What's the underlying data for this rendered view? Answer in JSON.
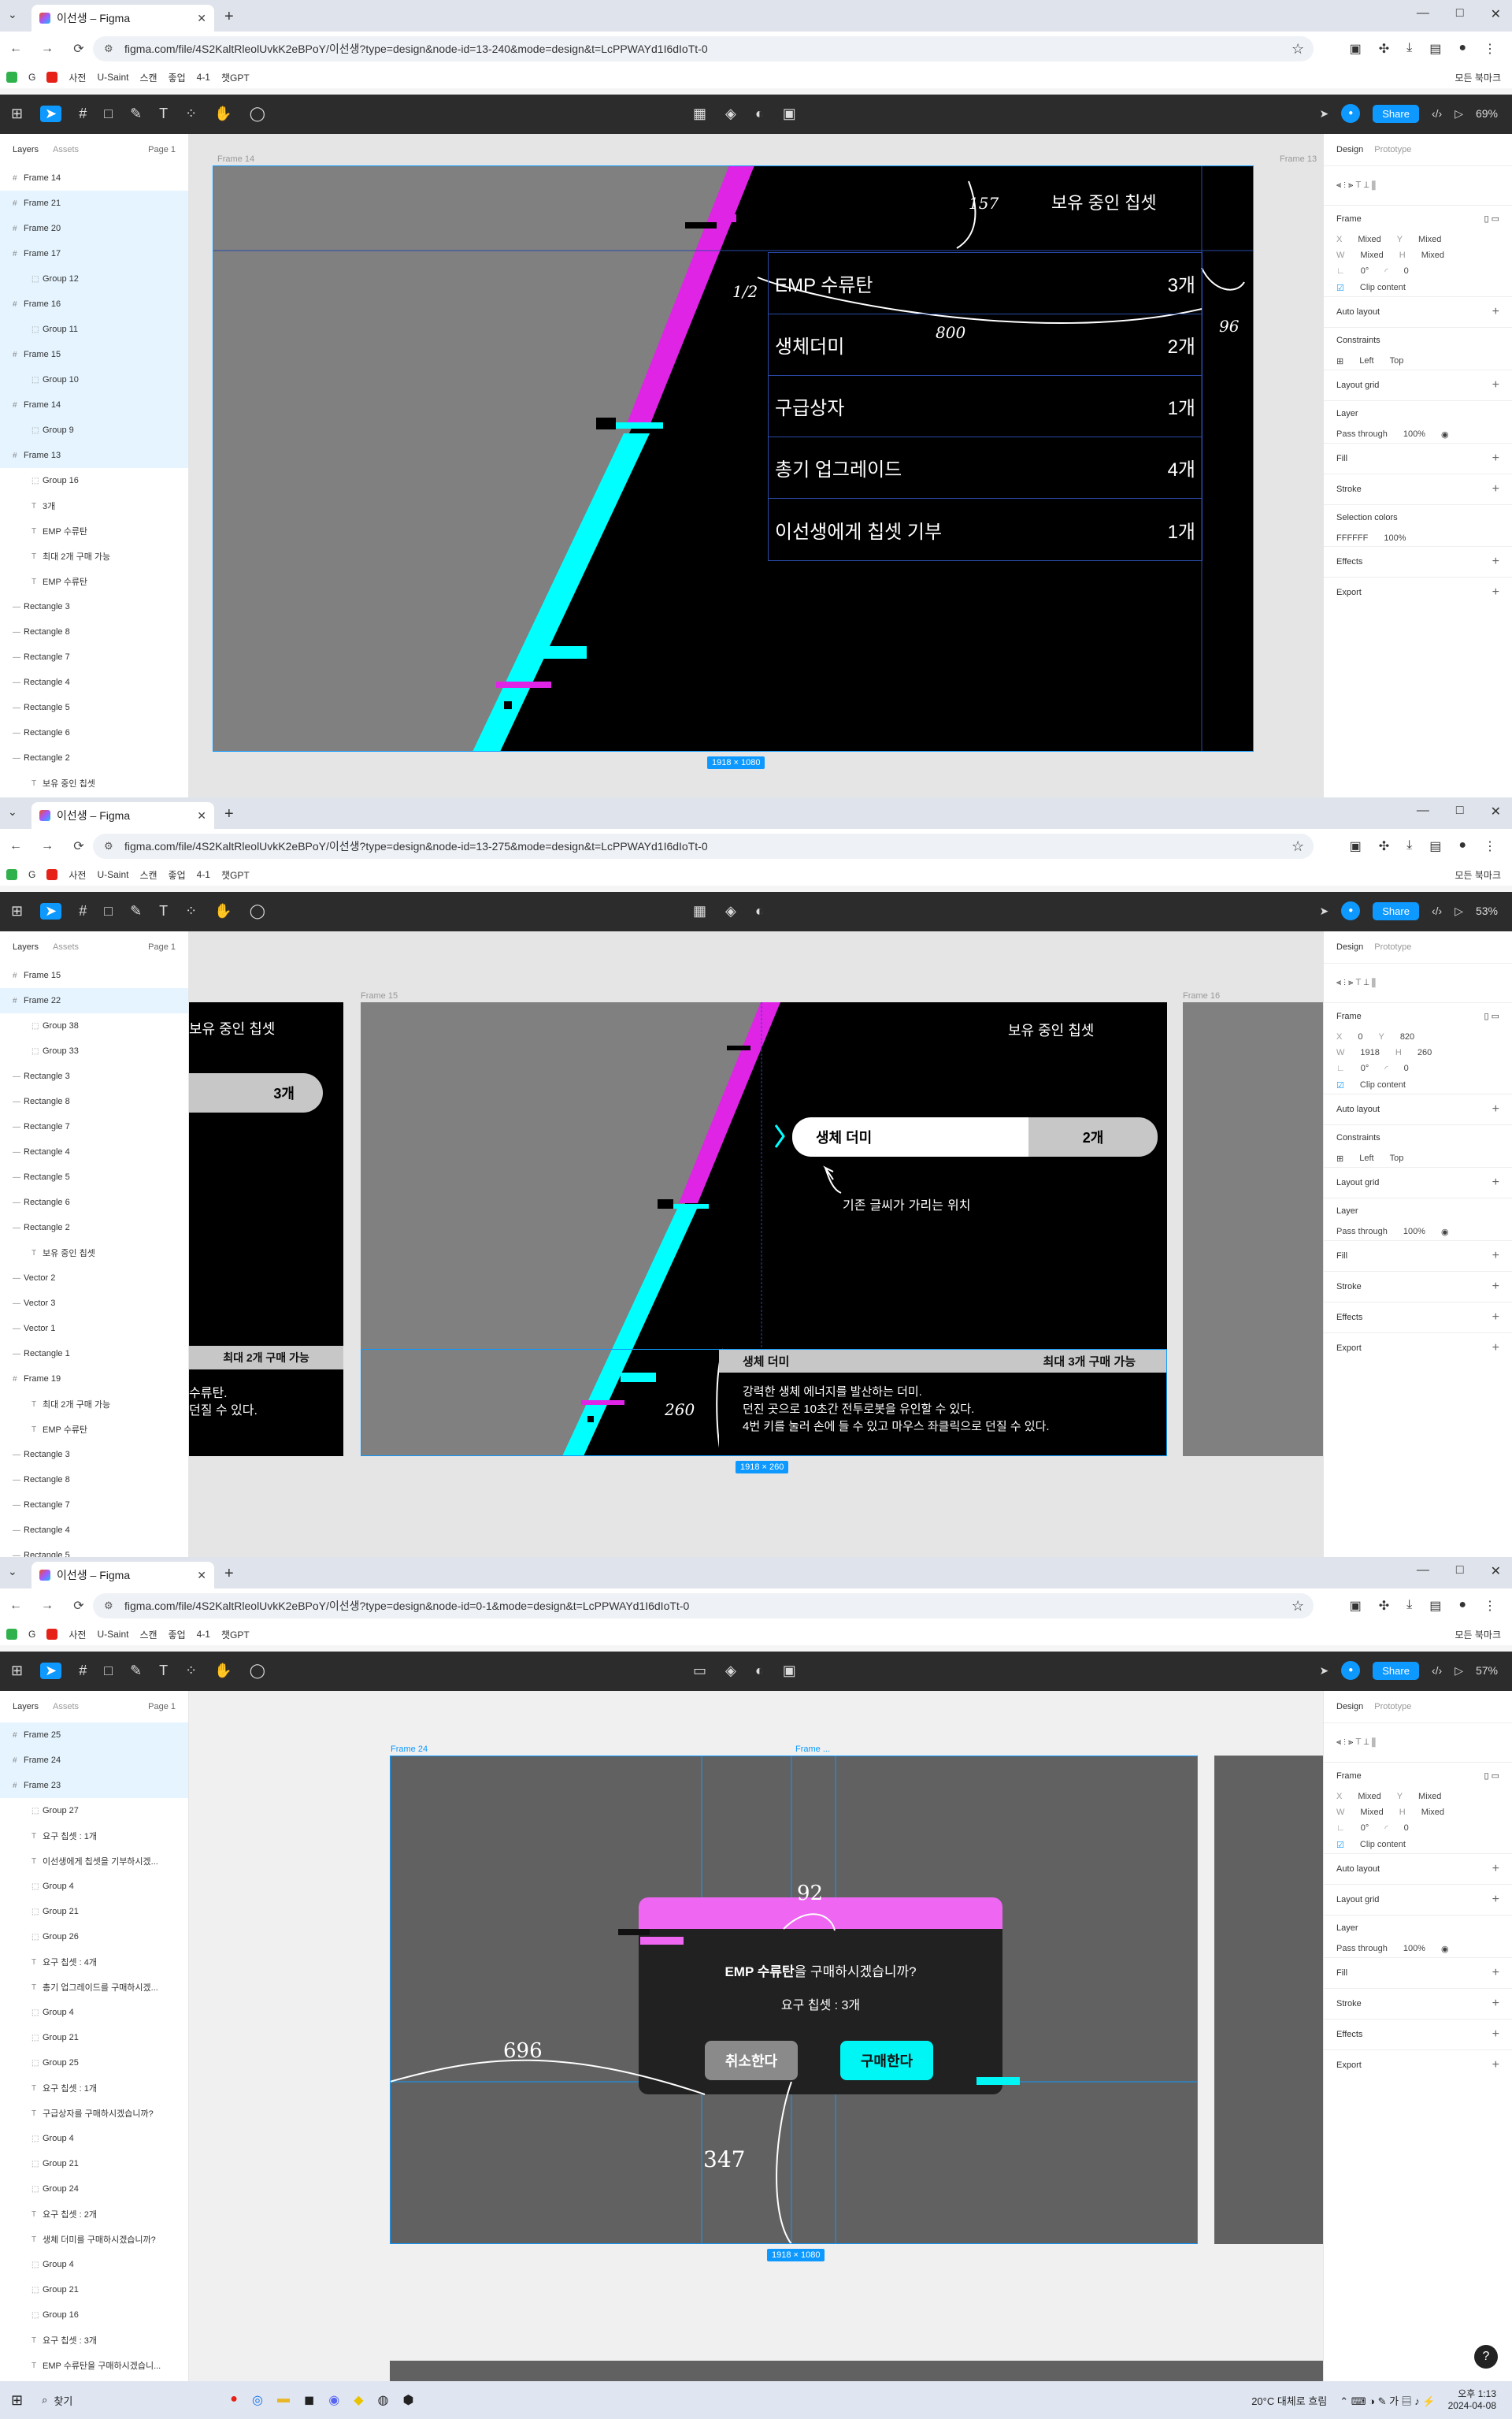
{
  "browser": {
    "tab_title": "이선생 – Figma",
    "window_controls": [
      "—",
      "□",
      "✕"
    ],
    "bookmarks": [
      "사전",
      "U-Saint",
      "스캔",
      "좋업",
      "4-1",
      "챗GPT"
    ],
    "all_bookmarks": "모든 북마크",
    "urls": [
      "figma.com/file/4S2KaltRleolUvkK2eBPoY/이선생?type=design&node-id=13-240&mode=design&t=LcPPWAYd1I6dIoTt-0",
      "figma.com/file/4S2KaltRleolUvkK2eBPoY/이선생?type=design&node-id=13-275&mode=design&t=LcPPWAYd1I6dIoTt-0",
      "figma.com/file/4S2KaltRleolUvkK2eBPoY/이선생?type=design&node-id=0-1&mode=design&t=LcPPWAYd1I6dIoTt-0"
    ]
  },
  "toolbar": {
    "share": "Share",
    "zooms": [
      "69%",
      "53%",
      "57%"
    ]
  },
  "layers_panel": {
    "tab_layers": "Layers",
    "tab_assets": "Assets",
    "page": "Page 1",
    "s1": [
      "Frame 14",
      "Frame 21",
      "Frame 20",
      "Frame 17",
      "Group 12",
      "Frame 16",
      "Group 11",
      "Frame 15",
      "Group 10",
      "Frame 14",
      "Group 9",
      "Frame 13",
      "Group 16",
      "3개",
      "EMP 수류탄",
      "최대 2개 구매 가능",
      "EMP 수류탄",
      "Rectangle 3",
      "Rectangle 8",
      "Rectangle 7",
      "Rectangle 4",
      "Rectangle 5",
      "Rectangle 6",
      "Rectangle 2",
      "보유 중인 칩셋"
    ],
    "s2": [
      "Frame 15",
      "Frame 22",
      "Group 38",
      "Group 33",
      "Rectangle 3",
      "Rectangle 8",
      "Rectangle 7",
      "Rectangle 4",
      "Rectangle 5",
      "Rectangle 6",
      "Rectangle 2",
      "보유 중인 칩셋",
      "Vector 2",
      "Vector 3",
      "Vector 1",
      "Rectangle 1",
      "Frame 19",
      "최대 2개 구매 가능",
      "EMP 수류탄",
      "Rectangle 3",
      "Rectangle 8",
      "Rectangle 7",
      "Rectangle 4",
      "Rectangle 5"
    ],
    "s3": [
      "Frame 25",
      "Frame 24",
      "Frame 23",
      "Group 27",
      "요구 칩셋 : 1개",
      "이선생에게 칩셋을 기부하시겠...",
      "Group 4",
      "Group 21",
      "Group 26",
      "요구 칩셋 : 4개",
      "총기 업그레이드를 구매하시겠...",
      "Group 4",
      "Group 21",
      "Group 25",
      "요구 칩셋 : 1개",
      "구급상자를 구매하시겠습니까?",
      "Group 4",
      "Group 21",
      "Group 24",
      "요구 칩셋 : 2개",
      "생체 더미를 구매하시겠습니까?",
      "Group 4",
      "Group 21",
      "Group 16",
      "요구 칩셋 : 3개",
      "EMP 수류탄을 구매하시겠습니..."
    ]
  },
  "design_panel": {
    "tab_design": "Design",
    "tab_prototype": "Prototype",
    "frame": "Frame",
    "x": "Mixed",
    "y": "Mixed",
    "w": "Mixed",
    "h": "Mixed",
    "frame2": {
      "x": "0",
      "y": "820",
      "w": "1918",
      "h": "260"
    },
    "rotation": "0°",
    "radius": "0",
    "clip": "Clip content",
    "auto_layout": "Auto layout",
    "constraints": "Constraints",
    "left": "Left",
    "top": "Top",
    "layout_grid": "Layout grid",
    "layer": "Layer",
    "pass_through": "Pass through",
    "opacity": "100%",
    "fill": "Fill",
    "stroke": "Stroke",
    "selection_colors": "Selection colors",
    "color_hex": "FFFFFF",
    "color_opacity": "100%",
    "effects": "Effects",
    "export": "Export"
  },
  "frame1": {
    "label": "Frame 14",
    "label_right": "Frame 13",
    "title": "보유 중인 칩셋",
    "items": [
      {
        "name": "EMP 수류탄",
        "count": "3개"
      },
      {
        "name": "생체더미",
        "count": "2개"
      },
      {
        "name": "구급상자",
        "count": "1개"
      },
      {
        "name": "총기 업그레이드",
        "count": "4개"
      },
      {
        "name": "이선생에게 칩셋 기부",
        "count": "1개"
      }
    ],
    "annotations": {
      "a1": "157",
      "a2": "1/2",
      "a3": "800",
      "a4": "96"
    },
    "dimensions": "1918 × 1080"
  },
  "frame2": {
    "label": "Frame 15",
    "label_right": "Frame 16",
    "title": "보유 중인 칩셋",
    "left_count": "3개",
    "pill_name": "생체 더미",
    "pill_count": "2개",
    "note": "기존 글씨가 가리는 위치",
    "left_bar": "최대 2개 구매 가능",
    "left_text_1": "수류탄.",
    "left_text_2": "던질 수 있다.",
    "desc_name": "생체 더미",
    "desc_limit": "최대 3개 구매 가능",
    "desc_lines": [
      "강력한 생체 에너지를 발산하는 더미.",
      "던진 곳으로 10초간 전투로봇을 유인할 수 있다.",
      "4번 키를 눌러 손에 들 수 있고 마우스 좌클릭으로 던질 수 있다."
    ],
    "annotation": "260",
    "dimensions": "1918 × 260"
  },
  "frame3": {
    "label": "Frame 24",
    "label_mid": "Frame ...",
    "question_bold": "EMP 수류탄",
    "question_rest": "을 구매하시겠습니까?",
    "required": "요구 칩셋 :  3개",
    "cancel": "취소한다",
    "buy": "구매한다",
    "annotations": {
      "a1": "92",
      "a2": "696",
      "a3": "347"
    },
    "dimensions": "1918 × 1080"
  },
  "taskbar": {
    "search": "찾기",
    "weather": "20°C  대체로 흐림",
    "time": "오후 1:13",
    "date": "2024-04-08"
  },
  "colors": {
    "magenta": "#e024e6",
    "cyan": "#00ffff",
    "dialog_top": "#ee66f2",
    "buy": "#00f5f5",
    "cancel": "#8a8a8a",
    "figma_blue": "#0d99ff"
  }
}
